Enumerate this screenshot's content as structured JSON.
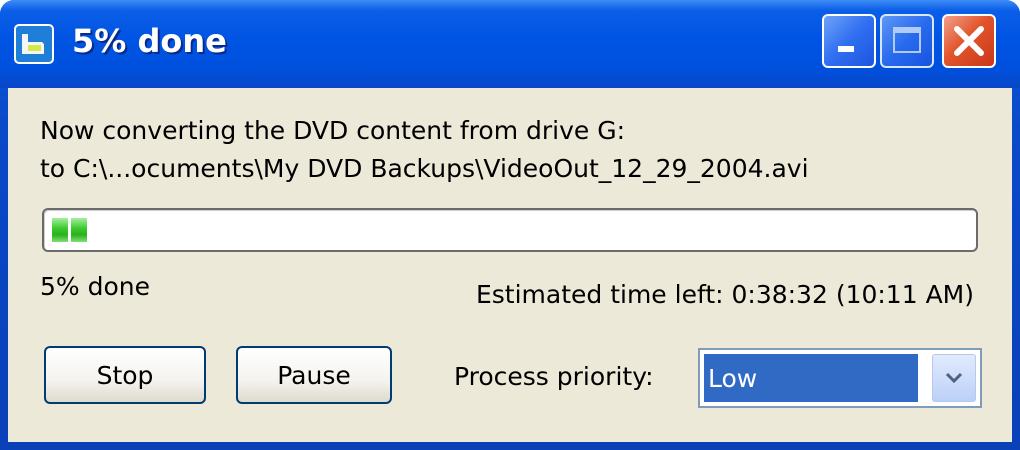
{
  "window": {
    "title": "5% done",
    "controls": {
      "minimize": "minimize-icon",
      "maximize": "maximize-icon",
      "close": "close-icon"
    }
  },
  "status": {
    "line1": "Now converting the DVD content from drive G:",
    "line2": "to C:\\...ocuments\\My DVD Backups\\VideoOut_12_29_2004.avi"
  },
  "progress": {
    "percent": 5,
    "label": "5% done",
    "eta": "Estimated time left: 0:38:32 (10:11 AM)",
    "bar_color": "#37c82b"
  },
  "buttons": {
    "stop": "Stop",
    "pause": "Pause"
  },
  "priority": {
    "label": "Process priority:",
    "selected": "Low"
  },
  "colors": {
    "titlebar": "#0054e3",
    "client_bg": "#ece9d8",
    "selection": "#316ac5",
    "close_button": "#e2542c"
  }
}
